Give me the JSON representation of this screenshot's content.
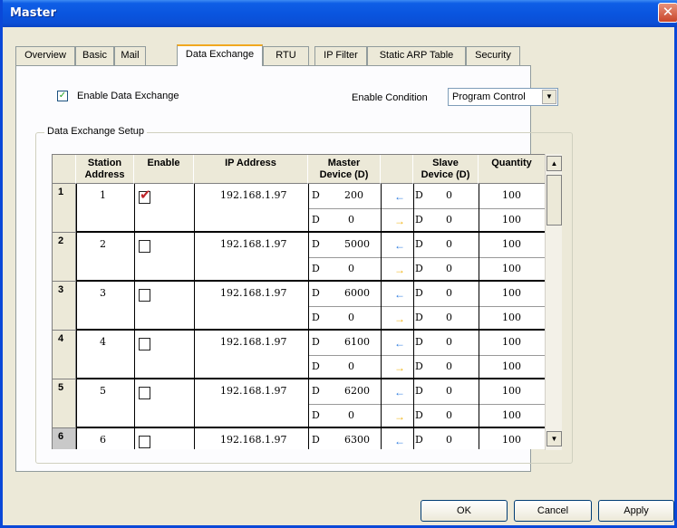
{
  "window": {
    "title": "Master",
    "close_glyph": "✕"
  },
  "tabs": [
    {
      "label": "Overview"
    },
    {
      "label": "Basic"
    },
    {
      "label": "Mail"
    },
    {
      "label": "Data Exchange"
    },
    {
      "label": "RTU"
    },
    {
      "label": "IP Filter"
    },
    {
      "label": "Static ARP Table"
    },
    {
      "label": "Security"
    }
  ],
  "active_tab": "Data Exchange",
  "enable_data_exchange": {
    "label": "Enable Data Exchange",
    "checked": true,
    "mark": "✓"
  },
  "enable_condition": {
    "label": "Enable Condition",
    "value": "Program Control",
    "arrow": "▼"
  },
  "group": {
    "label": "Data Exchange Setup"
  },
  "table": {
    "headers": {
      "station_a": "Station",
      "station_b": "Address",
      "enable": "Enable",
      "ip": "IP Address",
      "master_a": "Master",
      "master_b": "Device (D)",
      "slave_a": "Slave",
      "slave_b": "Device (D)",
      "quantity": "Quantity"
    },
    "rows": [
      {
        "no": "1",
        "station": "1",
        "enabled": true,
        "ip": "192.168.1.97",
        "master1_type": "D",
        "master1": "200",
        "master2_type": "D",
        "master2": "0",
        "slave1_type": "D",
        "slave1": "0",
        "slave2_type": "D",
        "slave2": "0",
        "qty1": "100",
        "qty2": "100"
      },
      {
        "no": "2",
        "station": "2",
        "enabled": false,
        "ip": "192.168.1.97",
        "master1_type": "D",
        "master1": "5000",
        "master2_type": "D",
        "master2": "0",
        "slave1_type": "D",
        "slave1": "0",
        "slave2_type": "D",
        "slave2": "0",
        "qty1": "100",
        "qty2": "100"
      },
      {
        "no": "3",
        "station": "3",
        "enabled": false,
        "ip": "192.168.1.97",
        "master1_type": "D",
        "master1": "6000",
        "master2_type": "D",
        "master2": "0",
        "slave1_type": "D",
        "slave1": "0",
        "slave2_type": "D",
        "slave2": "0",
        "qty1": "100",
        "qty2": "100"
      },
      {
        "no": "4",
        "station": "4",
        "enabled": false,
        "ip": "192.168.1.97",
        "master1_type": "D",
        "master1": "6100",
        "master2_type": "D",
        "master2": "0",
        "slave1_type": "D",
        "slave1": "0",
        "slave2_type": "D",
        "slave2": "0",
        "qty1": "100",
        "qty2": "100"
      },
      {
        "no": "5",
        "station": "5",
        "enabled": false,
        "ip": "192.168.1.97",
        "master1_type": "D",
        "master1": "6200",
        "master2_type": "D",
        "master2": "0",
        "slave1_type": "D",
        "slave1": "0",
        "slave2_type": "D",
        "slave2": "0",
        "qty1": "100",
        "qty2": "100"
      },
      {
        "no": "6",
        "station": "6",
        "enabled": false,
        "ip": "192.168.1.97",
        "master1_type": "D",
        "master1": "6300",
        "master2_type": "D",
        "master2": "",
        "slave1_type": "D",
        "slave1": "0",
        "slave2_type": "",
        "slave2": "",
        "qty1": "100",
        "qty2": ""
      }
    ],
    "arrow_left": "←",
    "arrow_right": "→"
  },
  "scrollbar": {
    "up": "▲",
    "down": "▼"
  },
  "buttons": {
    "ok": "OK",
    "cancel": "Cancel",
    "apply": "Apply"
  }
}
